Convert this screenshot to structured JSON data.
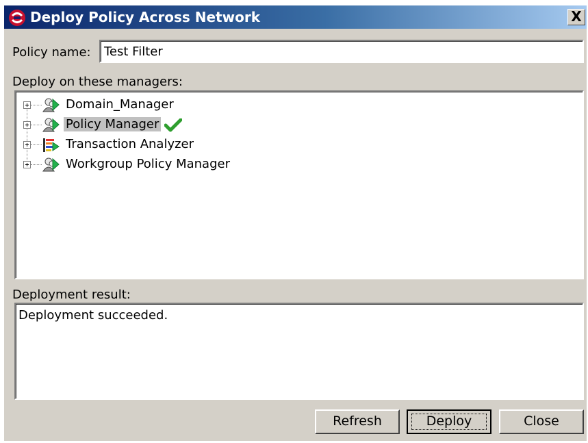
{
  "window": {
    "title": "Deploy Policy Across Network",
    "close_glyph": "X",
    "app_icon": "app-logo-icon",
    "close_icon": "close-icon"
  },
  "form": {
    "policy_name_label": "Policy name:",
    "policy_name_value": "Test Filter",
    "managers_label": "Deploy on these managers:",
    "result_label": "Deployment result:",
    "result_text": "Deployment succeeded."
  },
  "tree": {
    "items": [
      {
        "label": "Domain_Manager",
        "icon": "manager-icon",
        "selected": false,
        "deployed": false
      },
      {
        "label": "Policy Manager",
        "icon": "manager-icon",
        "selected": true,
        "deployed": true
      },
      {
        "label": "Transaction Analyzer",
        "icon": "analyzer-icon",
        "selected": false,
        "deployed": false
      },
      {
        "label": "Workgroup Policy Manager",
        "icon": "manager-icon",
        "selected": false,
        "deployed": false
      }
    ]
  },
  "buttons": {
    "refresh": "Refresh",
    "deploy": "Deploy",
    "close": "Close"
  },
  "colors": {
    "titlebar_start": "#0a246a",
    "titlebar_end": "#a6caf0",
    "dialog_bg": "#d4d0c8",
    "check_green": "#2e9e2e"
  }
}
